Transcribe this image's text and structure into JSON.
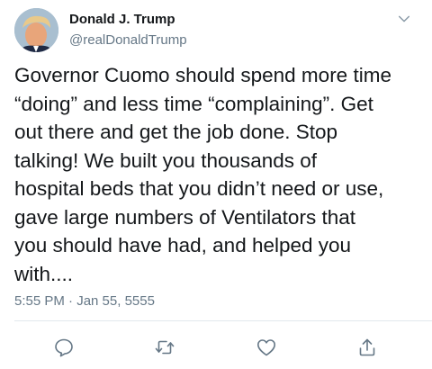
{
  "author": {
    "display_name": "Donald J. Trump",
    "handle": "@realDonaldTrump",
    "avatar_icon": "profile-photo"
  },
  "tweet": {
    "text": "Governor Cuomo should spend more time\n“doing” and less time “complaining”. Get\nout there and get the job done. Stop\ntalking! We built you thousands of\nhospital beds that you didn’t need or use,\ngave large numbers of Ventilators that\nyou should have had, and helped you\nwith....",
    "timestamp": "5:55 PM · Jan 55, 5555"
  },
  "actions": [
    {
      "name": "reply",
      "icon": "reply-icon"
    },
    {
      "name": "retweet",
      "icon": "retweet-icon"
    },
    {
      "name": "like",
      "icon": "heart-icon"
    },
    {
      "name": "share",
      "icon": "share-icon"
    }
  ],
  "colors": {
    "text": "#14171a",
    "secondary_text": "#657786",
    "icon": "#657786",
    "divider": "#e1e8ed",
    "background": "#ffffff"
  }
}
